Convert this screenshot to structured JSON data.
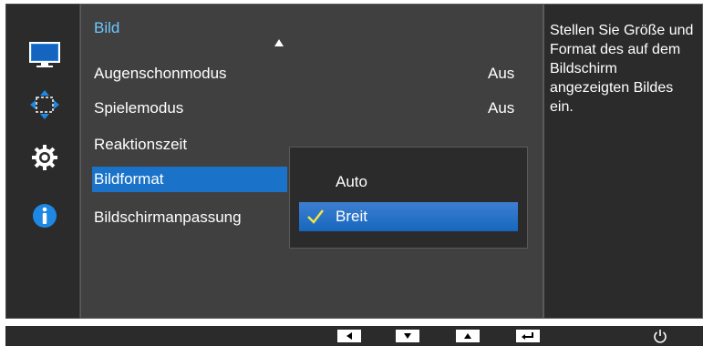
{
  "menu": {
    "title": "Bild",
    "items": [
      {
        "label": "Augenschonmodus",
        "value": "Aus"
      },
      {
        "label": "Spielemodus",
        "value": "Aus"
      },
      {
        "label": "Reaktionszeit",
        "value": ""
      },
      {
        "label": "Bildformat",
        "value": ""
      },
      {
        "label": "Bildschirmanpassung",
        "value": ""
      }
    ],
    "selected_index": 3
  },
  "submenu": {
    "options": [
      {
        "label": "Auto",
        "checked": false
      },
      {
        "label": "Breit",
        "checked": true
      }
    ]
  },
  "help": {
    "text": "Stellen Sie Größe und Format des auf dem Bildschirm angezeigten Bildes ein."
  },
  "sidebar": {
    "icons": [
      "monitor-icon",
      "position-icon",
      "gear-icon",
      "info-icon"
    ]
  },
  "bottom_bar": {
    "keys": [
      "left-arrow-icon",
      "down-arrow-icon",
      "up-arrow-icon",
      "enter-icon",
      "power-icon"
    ]
  },
  "colors": {
    "accent": "#6ec6ff",
    "selection": "#1a73c9",
    "check": "#f5e14a"
  }
}
